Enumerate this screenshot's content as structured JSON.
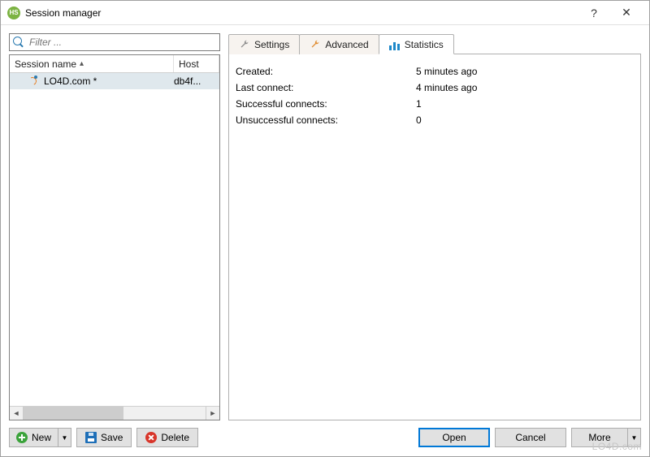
{
  "window": {
    "title": "Session manager"
  },
  "filter": {
    "placeholder": "Filter ..."
  },
  "columns": {
    "session_name": "Session name",
    "host": "Host",
    "sort_indicator": "▴"
  },
  "rows": [
    {
      "name": "LO4D.com *",
      "host": "db4f..."
    }
  ],
  "tabs": {
    "settings": "Settings",
    "advanced": "Advanced",
    "statistics": "Statistics",
    "active": "statistics"
  },
  "stats": {
    "created_label": "Created:",
    "created_value": "5 minutes ago",
    "lastconn_label": "Last connect:",
    "lastconn_value": "4 minutes ago",
    "succ_label": "Successful connects:",
    "succ_value": "1",
    "unsucc_label": "Unsuccessful connects:",
    "unsucc_value": "0"
  },
  "buttons": {
    "new": "New",
    "save": "Save",
    "delete": "Delete",
    "open": "Open",
    "cancel": "Cancel",
    "more": "More"
  },
  "watermark": "LO4D.com"
}
